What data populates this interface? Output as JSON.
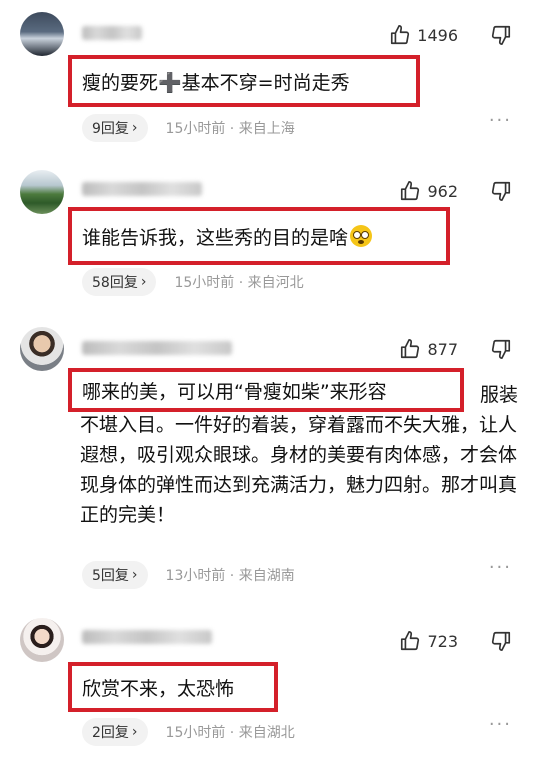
{
  "comments": [
    {
      "likes": "1496",
      "text": "瘦的要死➕基本不穿=时尚走秀",
      "reply_label": "9回复",
      "meta": "15小时前 · 来自上海"
    },
    {
      "likes": "962",
      "text": "谁能告诉我，这些秀的目的是啥",
      "reply_label": "58回复",
      "meta": "15小时前 · 来自河北"
    },
    {
      "likes": "877",
      "text": "哪来的美，可以用“骨瘦如柴”来形容",
      "continuation": "服装不堪入目。一件好的着装，穿着露而不失大雅，让人遐想，吸引观众眼球。身材的美要有肉体感，才会体现身体的弹性而达到充满活力，魅力四射。那才叫真正的完美！",
      "reply_label": "5回复",
      "meta": "13小时前 · 来自湖南"
    },
    {
      "likes": "723",
      "text": "欣赏不来，太恐怖",
      "reply_label": "2回复",
      "meta": "15小时前 · 来自湖北"
    }
  ],
  "icons": {
    "like": "thumbs-up-icon",
    "dislike": "thumbs-down-icon",
    "more": "more-dots-icon",
    "chevron": "chevron-right-icon",
    "emoji": "flushed-face-icon"
  },
  "colors": {
    "highlight_border": "#d4202a",
    "meta_text": "#999999"
  }
}
